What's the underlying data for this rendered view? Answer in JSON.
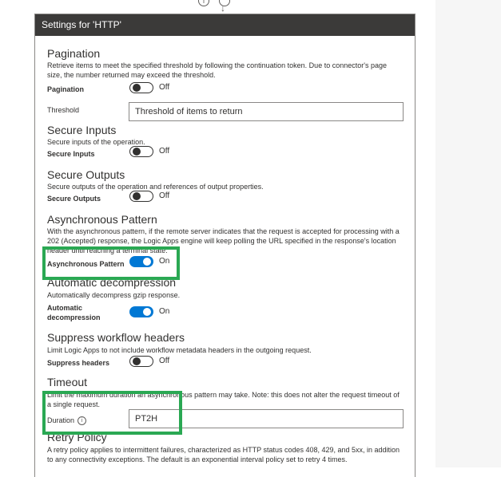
{
  "window": {
    "title": "Settings for 'HTTP'"
  },
  "top_icons": {
    "info": "info-icon",
    "add": "add-step-icon",
    "arrow": "arrow-down-icon"
  },
  "pagination": {
    "title": "Pagination",
    "description": "Retrieve items to meet the specified threshold by following the continuation token. Due to connector's page size, the number returned may exceed the threshold.",
    "toggle_label": "Pagination",
    "state": "Off",
    "threshold_label": "Threshold",
    "threshold_placeholder": "Threshold of items to return"
  },
  "secure_inputs": {
    "title": "Secure Inputs",
    "description": "Secure inputs of the operation.",
    "toggle_label": "Secure Inputs",
    "state": "Off"
  },
  "secure_outputs": {
    "title": "Secure Outputs",
    "description": "Secure outputs of the operation and references of output properties.",
    "toggle_label": "Secure Outputs",
    "state": "Off"
  },
  "async_pattern": {
    "title": "Asynchronous Pattern",
    "description": "With the asynchronous pattern, if the remote server indicates that the request is accepted for processing with a 202 (Accepted) response, the Logic Apps engine will keep polling the URL specified in the response's location header until reaching a terminal state.",
    "toggle_label": "Asynchronous Pattern",
    "state": "On"
  },
  "auto_decompress": {
    "title": "Automatic decompression",
    "description": "Automatically decompress gzip response.",
    "toggle_label_line1": "Automatic",
    "toggle_label_line2": "decompression",
    "state": "On"
  },
  "suppress_headers": {
    "title": "Suppress workflow headers",
    "description": "Limit Logic Apps to not include workflow metadata headers in the outgoing request.",
    "toggle_label": "Suppress headers",
    "state": "Off"
  },
  "timeout": {
    "title": "Timeout",
    "description": "Limit the maximum duration an asynchronous pattern may take. Note: this does not alter the request timeout of a single request.",
    "duration_label": "Duration",
    "duration_value": "PT2H"
  },
  "retry_policy": {
    "title": "Retry Policy",
    "description": "A retry policy applies to intermittent failures, characterized as HTTP status codes 408, 429, and 5xx, in addition to any connectivity exceptions. The default is an exponential interval policy set to retry 4 times."
  },
  "colors": {
    "accent": "#0078d4",
    "highlight": "#2aa853",
    "header_bg": "#3b3a39"
  }
}
